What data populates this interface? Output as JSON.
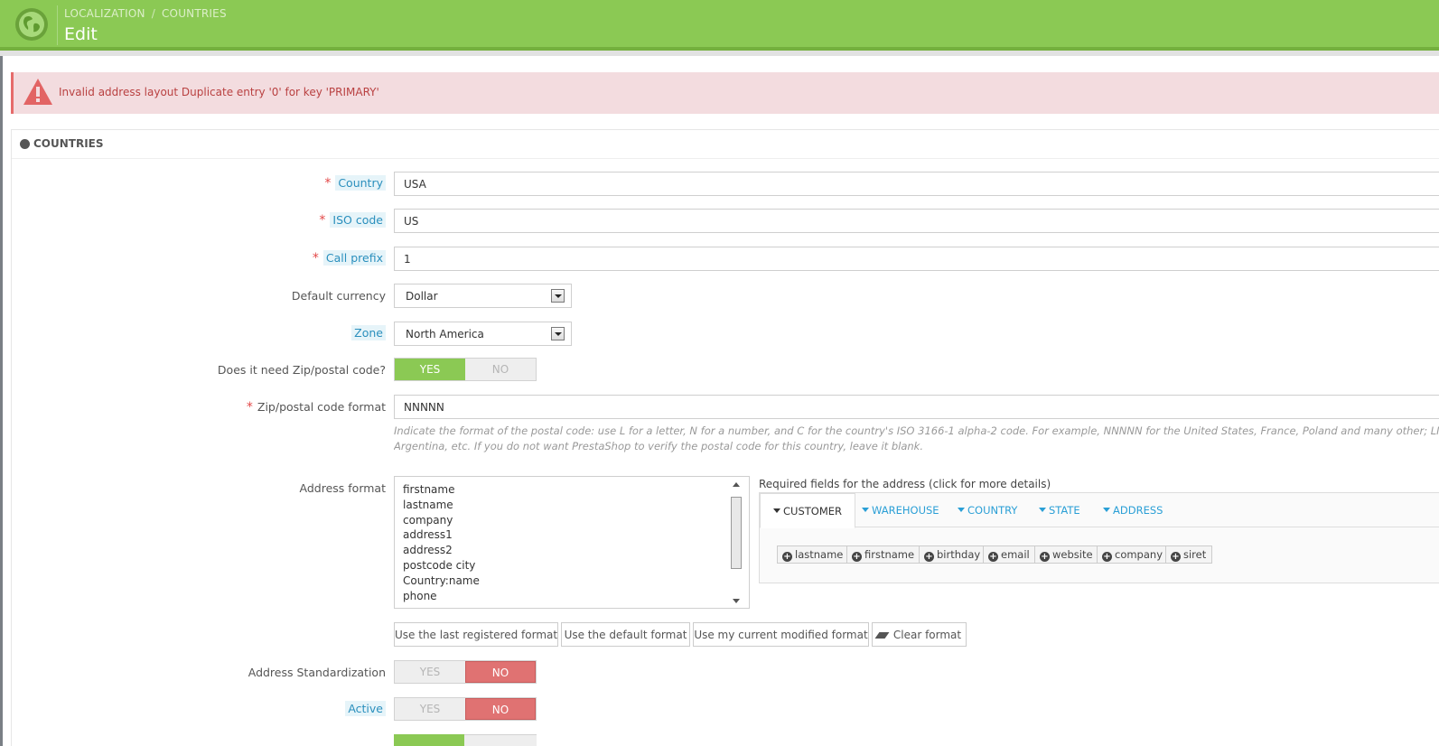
{
  "header": {
    "breadcrumb": [
      "LOCALIZATION",
      "COUNTRIES"
    ],
    "breadcrumb_separator": "/",
    "title": "Edit",
    "icon": "globe-icon"
  },
  "alert": {
    "message": "Invalid address layout Duplicate entry '0' for key 'PRIMARY'",
    "icon": "warning-triangle-icon"
  },
  "panel": {
    "title": "COUNTRIES",
    "icon": "globe-icon"
  },
  "form": {
    "country": {
      "label": "Country",
      "value": "USA",
      "required": true
    },
    "iso_code": {
      "label": "ISO code",
      "value": "US",
      "required": true
    },
    "call_prefix": {
      "label": "Call prefix",
      "value": "1",
      "required": true
    },
    "default_currency": {
      "label": "Default currency",
      "value": "Dollar"
    },
    "zone": {
      "label": "Zone",
      "value": "North America"
    },
    "need_zip": {
      "label": "Does it need Zip/postal code?",
      "yes": "YES",
      "no": "NO",
      "value": "YES"
    },
    "zip_format": {
      "label": "Zip/postal code format",
      "value": "NNNNN",
      "required": true,
      "help_line1": "Indicate the format of the postal code: use L for a letter, N for a number, and C for the country's ISO 3166-1 alpha-2 code. For example, NNNNN for the United States, France, Poland and many other; LNNNN",
      "help_line2": "Argentina, etc. If you do not want PrestaShop to verify the postal code for this country, leave it blank."
    },
    "address_format": {
      "label": "Address format",
      "lines": [
        "firstname",
        "lastname",
        "company",
        "address1",
        "address2",
        "postcode city",
        "Country:name",
        "phone"
      ]
    },
    "required_fields": {
      "title": "Required fields for the address (click for more details)",
      "tabs": [
        "CUSTOMER",
        "WAREHOUSE",
        "COUNTRY",
        "STATE",
        "ADDRESS"
      ],
      "active_tab": "CUSTOMER",
      "tags": [
        "lastname",
        "firstname",
        "birthday",
        "email",
        "website",
        "company",
        "siret"
      ]
    },
    "format_buttons": {
      "last_registered": "Use the last registered format",
      "default": "Use the default format",
      "current_modified": "Use my current modified format",
      "clear": "Clear format"
    },
    "address_standardization": {
      "label": "Address Standardization",
      "yes": "YES",
      "no": "NO",
      "value": "NO"
    },
    "active": {
      "label": "Active",
      "yes": "YES",
      "no": "NO",
      "value": "NO"
    }
  },
  "colors": {
    "header_green": "#8bc954",
    "alert_bg": "#f3dcdf",
    "alert_text": "#b94141",
    "switch_yes": "#8bc954",
    "switch_no": "#e07272",
    "link_blue": "#2a9fd6"
  }
}
